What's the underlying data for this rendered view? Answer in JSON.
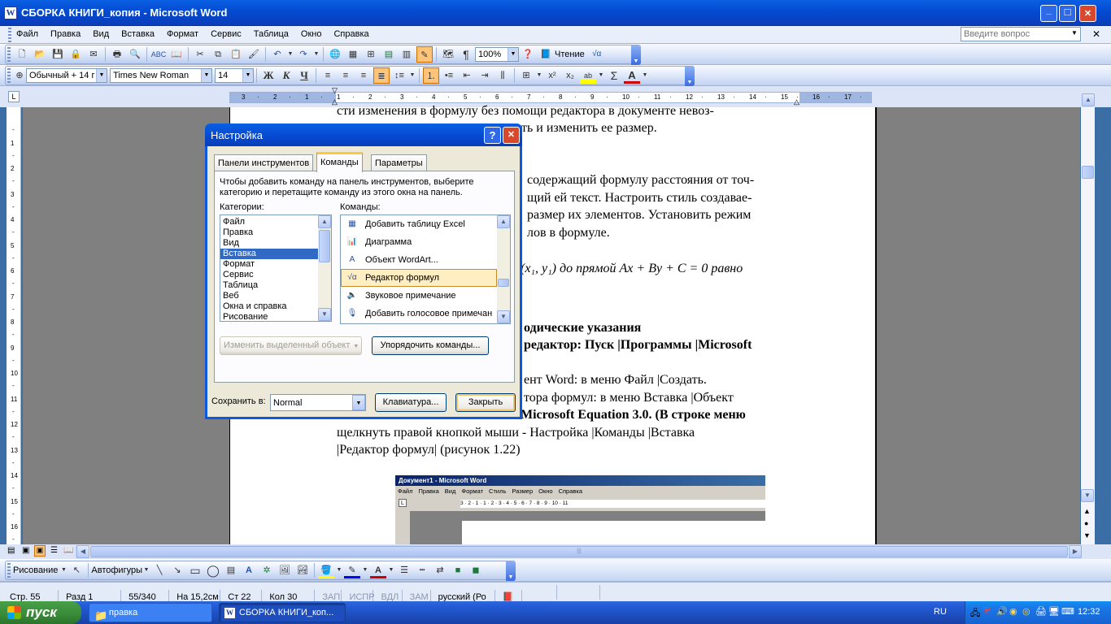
{
  "window": {
    "title": "СБОРКА КНИГИ_копия - Microsoft Word"
  },
  "menu": {
    "items": [
      "Файл",
      "Правка",
      "Вид",
      "Вставка",
      "Формат",
      "Сервис",
      "Таблица",
      "Окно",
      "Справка"
    ],
    "help_placeholder": "Введите вопрос"
  },
  "standard_toolbar": {
    "zoom": "100%",
    "read_label": "Чтение"
  },
  "formatting_toolbar": {
    "style": "Обычный + 14 г",
    "font": "Times New Roman",
    "size": "14"
  },
  "ruler": {
    "labels": [
      "3",
      "2",
      "1",
      "1",
      "2",
      "3",
      "4",
      "5",
      "6",
      "7",
      "8",
      "9",
      "10",
      "11",
      "12",
      "13",
      "14",
      "15",
      "16",
      "17"
    ]
  },
  "document": {
    "lines": [
      "сти изменения в формулу без помощи редактора в документе невоз-",
      "ть и изменить ее размер.",
      "содержащий формулу расстояния от точ-",
      "щий ей текст. Настроить стиль создавае-",
      "размер их элементов. Установить режим",
      "лов в формуле.",
      "одические указания",
      "редактор: Пуск |Программы |Microsoft",
      "ент Word: в меню Файл |Создать.",
      "тора формул: в меню Вставка |Объект",
      "Microsoft Equation 3.0. (В строке меню",
      "щелкнуть правой кнопкой мыши - Настройка |Команды |Вставка",
      "|Редактор формул| (рисунок 1.22)"
    ],
    "formula": "(x₁, y₁)  до прямой  Ax + By + C = 0  равно"
  },
  "embedded": {
    "title": "Документ1 - Microsoft Word",
    "menu": [
      "Файл",
      "Правка",
      "Вид",
      "Формат",
      "Стиль",
      "Размер",
      "Окно",
      "Справка"
    ],
    "ruler": "3 · 2 · 1 · 1 · 2 · 3 · 4 · 5 · 6 · 7 · 8 · 9 · 10 · 11"
  },
  "dialog": {
    "title": "Настройка",
    "tabs": [
      "Панели инструментов",
      "Команды",
      "Параметры"
    ],
    "instructions": "Чтобы добавить команду на панель инструментов, выберите категорию и перетащите команду из этого окна на панель.",
    "categories_label": "Категории:",
    "commands_label": "Команды:",
    "categories": [
      "Файл",
      "Правка",
      "Вид",
      "Вставка",
      "Формат",
      "Сервис",
      "Таблица",
      "Веб",
      "Окна и справка",
      "Рисование"
    ],
    "selected_category": 3,
    "commands": [
      "Добавить таблицу Excel",
      "Диаграмма",
      "Объект WordArt...",
      "Редактор формул",
      "Звуковое примечание",
      "Добавить голосовое примечан"
    ],
    "selected_command": 3,
    "modify_button": "Изменить выделенный объект",
    "rearrange_button": "Упорядочить команды...",
    "save_in_label": "Сохранить в:",
    "save_in_value": "Normal",
    "keyboard_button": "Клавиатура...",
    "close_button": "Закрыть"
  },
  "drawing_toolbar": {
    "draw_label": "Рисование",
    "autoshapes_label": "Автофигуры"
  },
  "status_bar": {
    "page": "Стр.  55",
    "section": "Разд  1",
    "pages": "55/340",
    "at": "На 15,2см",
    "line": "Ст  22",
    "col": "Кол  30",
    "rec": "ЗАП",
    "trk": "ИСПР",
    "ext": "ВДЛ",
    "ovr": "ЗАМ",
    "lang": "русский (Ро"
  },
  "taskbar": {
    "start": "пуск",
    "items": [
      "правка",
      "СБОРКА КНИГИ_коп..."
    ],
    "lang": "RU",
    "time": "12:32"
  },
  "colors": {
    "xp_blue": "#0a246a",
    "selection": "#316ac5",
    "hover_orange": "#ffc47a",
    "start_green": "#3c9a3c"
  }
}
